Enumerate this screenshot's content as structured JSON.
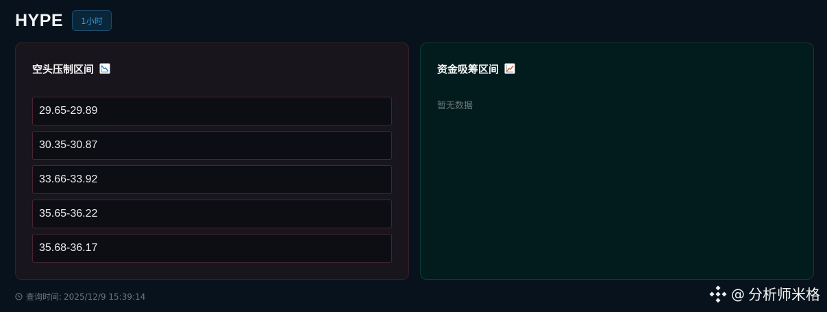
{
  "header": {
    "title": "HYPE",
    "timeframe_badge": "1小时"
  },
  "short_zone": {
    "title": "空头压制区间",
    "icon": "chart-decreasing-icon",
    "ranges": [
      "29.65-29.89",
      "30.35-30.87",
      "33.66-33.92",
      "35.65-36.22",
      "35.68-36.17"
    ]
  },
  "long_zone": {
    "title": "资金吸筹区间",
    "icon": "chart-increasing-icon",
    "empty_text": "暂无数据"
  },
  "footer": {
    "query_label": "查询时间:",
    "query_time": "2025/12/9 15:39:14"
  },
  "watermark": {
    "at": "@",
    "name": "分析师米格",
    "icon": "binance-logo-icon"
  },
  "colors": {
    "background": "#08121c",
    "short_panel": "#18151d",
    "long_panel": "#021c1e",
    "accent_blue": "#2ea4e6"
  }
}
